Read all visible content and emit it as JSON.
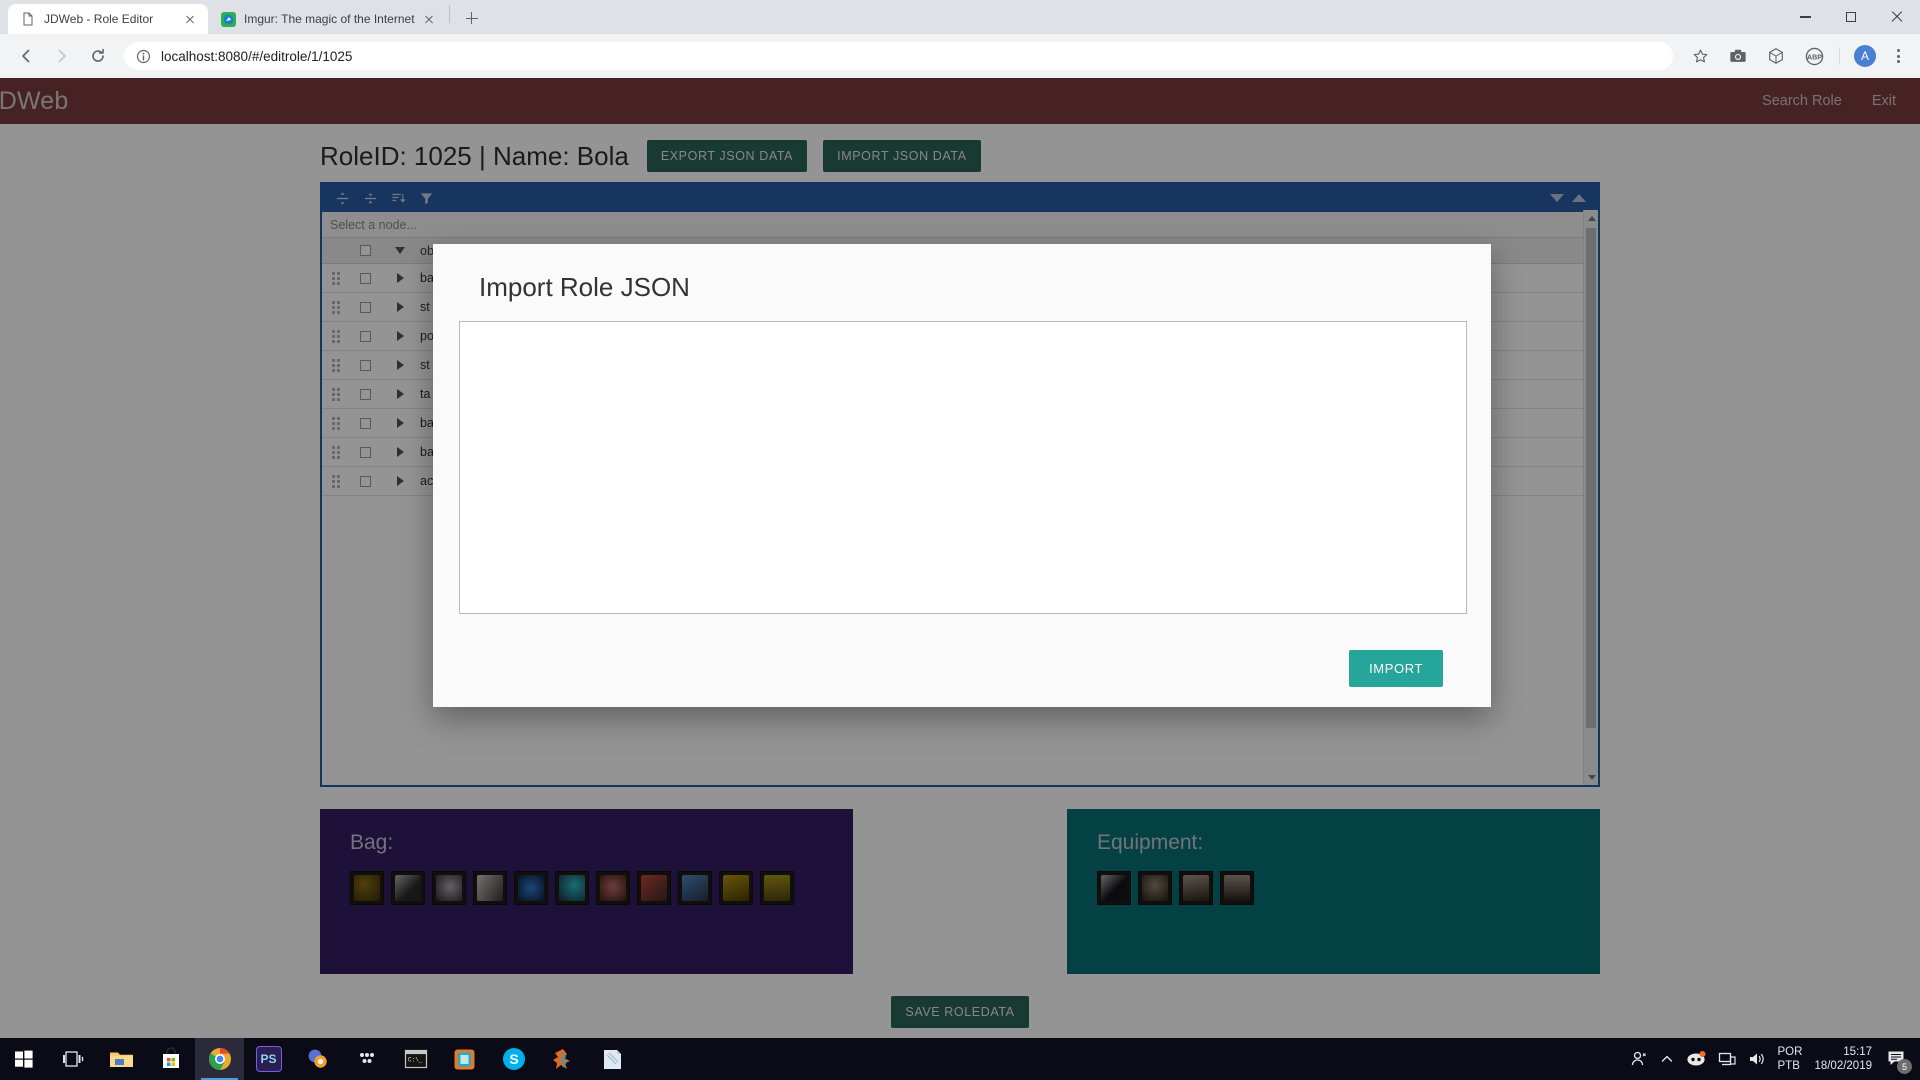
{
  "browser": {
    "tabs": [
      {
        "title": "JDWeb - Role Editor",
        "favicon": "page-icon",
        "active": true
      },
      {
        "title": "Imgur: The magic of the Internet",
        "favicon": "imgur-icon",
        "active": false
      }
    ],
    "new_tab_label": "+",
    "url_prefix": "localhost:8080",
    "url_path": "/#/editrole/1/1025",
    "url_full": "localhost:8080/#/editrole/1/1025",
    "toolbar_icons": [
      "back-icon",
      "forward-icon",
      "reload-icon",
      "info-icon",
      "star-icon",
      "camera-icon",
      "cube-icon",
      "abp-icon",
      "profile-avatar",
      "kebab-menu-icon"
    ],
    "avatar_letter": "A",
    "window_controls": [
      "minimize",
      "maximize",
      "close"
    ]
  },
  "app": {
    "brand": "JDWeb",
    "nav": [
      "Search Role",
      "Exit"
    ],
    "title": "RoleID: 1025 | Name: Bola",
    "export_button": "EXPORT JSON DATA",
    "import_button": "IMPORT JSON DATA",
    "save_button": "SAVE ROLEDATA",
    "accent_header": "#7b3b3e",
    "accent_button": "#2c6258"
  },
  "tree": {
    "toolbar_icons": [
      "expand-all-icon",
      "collapse-all-icon",
      "sort-icon",
      "filter-icon"
    ],
    "filter_placeholder": "Select a node...",
    "root_label": "object",
    "rows": [
      {
        "label": "ba"
      },
      {
        "label": "st"
      },
      {
        "label": "po"
      },
      {
        "label": "st"
      },
      {
        "label": "ta"
      },
      {
        "label": "ba"
      },
      {
        "label": "ba"
      },
      {
        "label": "ac"
      }
    ]
  },
  "bag": {
    "title": "Bag:",
    "slot_count": 11,
    "background": "#321e63",
    "items": [
      {
        "name": "gold-dragon-token",
        "c1": "#8a6d15",
        "c2": "#3a2f08"
      },
      {
        "name": "silver-spear",
        "c1": "#9a9a9a",
        "c2": "#2a2a2a"
      },
      {
        "name": "crescent-charm",
        "c1": "#b0a6b5",
        "c2": "#2b2530"
      },
      {
        "name": "scroll-fragment",
        "c1": "#c8c2c2",
        "c2": "#3a3435"
      },
      {
        "name": "blue-orb",
        "c1": "#2f7fd0",
        "c2": "#0d1b36"
      },
      {
        "name": "cyan-key",
        "c1": "#2fb8c8",
        "c2": "#16303a"
      },
      {
        "name": "red-coral",
        "c1": "#c06a62",
        "c2": "#3b1f1c"
      },
      {
        "name": "red-rune-scroll",
        "c1": "#c2453a",
        "c2": "#3a2a28"
      },
      {
        "name": "blue-manual",
        "c1": "#4f86c6",
        "c2": "#2b3344"
      },
      {
        "name": "gold-tome",
        "c1": "#b39410",
        "c2": "#4a3c06"
      },
      {
        "name": "treasure-map",
        "c1": "#a9941f",
        "c2": "#4d4410"
      }
    ]
  },
  "equipment": {
    "title": "Equipment:",
    "slot_count": 4,
    "background": "#077078",
    "items": [
      {
        "name": "dagger-weapon",
        "c1": "#9c9c9c",
        "c2": "#17141a"
      },
      {
        "name": "helmet-armor",
        "c1": "#8d8070",
        "c2": "#241e16"
      },
      {
        "name": "chest-armor",
        "c1": "#a39383",
        "c2": "#2a221a"
      },
      {
        "name": "boots-armor",
        "c1": "#9b9086",
        "c2": "#262019"
      }
    ]
  },
  "modal": {
    "title": "Import Role JSON",
    "textarea_value": "",
    "textarea_placeholder": "",
    "import_button": "IMPORT",
    "accent": "#26a69a"
  },
  "taskbar": {
    "items": [
      {
        "name": "start-button"
      },
      {
        "name": "task-view-button"
      },
      {
        "name": "file-explorer-icon"
      },
      {
        "name": "microsoft-store-icon"
      },
      {
        "name": "google-chrome-icon",
        "active": true
      },
      {
        "name": "photoshop-icon"
      },
      {
        "name": "app-icon-6"
      },
      {
        "name": "app-icon-7"
      },
      {
        "name": "cmd-icon"
      },
      {
        "name": "app-icon-9"
      },
      {
        "name": "skype-icon"
      },
      {
        "name": "app-icon-11"
      },
      {
        "name": "app-icon-12"
      }
    ],
    "tray": {
      "person_icon": "person-icon",
      "chevron_icon": "chevron-up-icon",
      "discord_icon": "discord-icon",
      "network_icon": "network-icon",
      "volume_icon": "volume-icon",
      "lang_line1": "POR",
      "lang_line2": "PTB",
      "time": "15:17",
      "date": "18/02/2019",
      "notification_count": "5"
    }
  }
}
